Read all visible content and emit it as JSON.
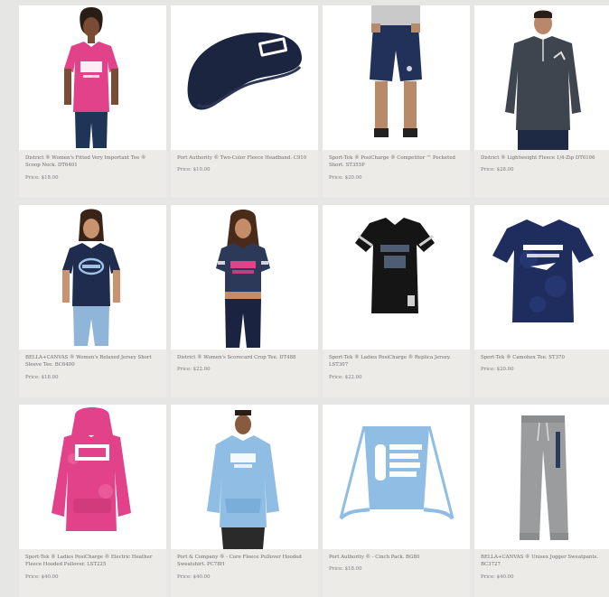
{
  "products": [
    {
      "name": "District ® Women's Fitted Very Important Tee ® Scoop Neck. DT6401",
      "price": "Price: $18.00",
      "icon": "shirt-icon"
    },
    {
      "name": "Port Authority ® Two-Color Fleece Headband. C910",
      "price": "Price: $10.00",
      "icon": "headband-icon"
    },
    {
      "name": "Sport-Tek ® PosiCharge ® Competitor ™ Pocketed Short. ST355P",
      "price": "Price: $20.00",
      "icon": "shorts-icon"
    },
    {
      "name": "District ® Lightweight Fleece 1/4-Zip DT6106",
      "price": "Price: $28.00",
      "icon": "quarter-zip-icon"
    },
    {
      "name": "BELLA+CANVAS ® Women's Relaxed Jersey Short Sleeve Tee. BC6400",
      "price": "Price: $18.00",
      "icon": "shirt-icon"
    },
    {
      "name": "District ® Women's Scorecard Crop Tee. DT488",
      "price": "Price: $22.00",
      "icon": "shirt-icon"
    },
    {
      "name": "Sport-Tek ® Ladies PosiCharge ® Replica Jersey. LST307",
      "price": "Price: $22.00",
      "icon": "jersey-icon"
    },
    {
      "name": "Sport-Tek ® Camohex Tee. ST370",
      "price": "Price: $20.00",
      "icon": "shirt-icon"
    },
    {
      "name": "Sport-Tek ® Ladies PosiCharge ® Electric Heather Fleece Hooded Pullover. LST225",
      "price": "Price: $40.00",
      "icon": "hoodie-icon"
    },
    {
      "name": "Port & Company ® - Core Fleece Pullover Hooded Sweatshirt. PC78H",
      "price": "Price: $40.00",
      "icon": "hoodie-icon"
    },
    {
      "name": "Port Authority ® - Cinch Pack. BG80",
      "price": "Price: $18.00",
      "icon": "bag-icon"
    },
    {
      "name": "BELLA+CANVAS ® Unisex Jogger Sweatpants. BC3727",
      "price": "Price: $40.00",
      "icon": "pants-icon"
    }
  ],
  "colors": {
    "page_bg": "#e6e6e4",
    "card_bg": "#ffffff",
    "info_bg": "#ecebe8",
    "pink": "#e2428a",
    "navy": "#1f2c4d",
    "heather_navy": "#2c3958",
    "charcoal": "#3f454f",
    "light_blue": "#8fbde3",
    "gray": "#9a9c9e",
    "black": "#151515"
  }
}
